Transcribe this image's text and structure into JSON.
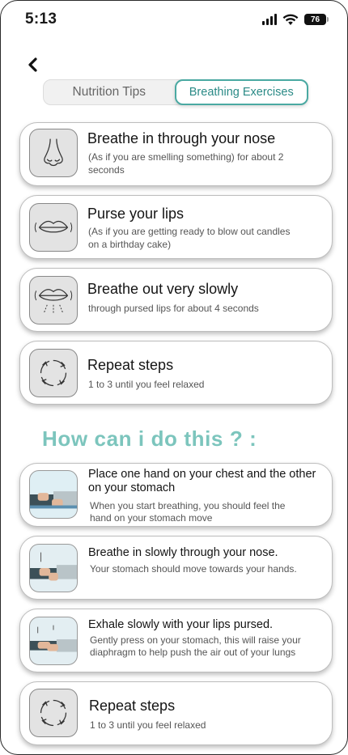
{
  "status": {
    "time": "5:13",
    "battery": "76"
  },
  "tabs": [
    {
      "label": "Nutrition Tips",
      "active": false
    },
    {
      "label": "Breathing Exercises",
      "active": true
    }
  ],
  "steps": [
    {
      "icon": "nose-icon",
      "title": "Breathe in through your nose",
      "desc": "(As if you are smelling something) for about 2 seconds"
    },
    {
      "icon": "lips-icon",
      "title": "Purse your lips",
      "desc": "(As if you are getting ready to blow out candles on a birthday cake)"
    },
    {
      "icon": "exhale-lips-icon",
      "title": "Breathe out very slowly",
      "desc": "through pursed lips for about 4 seconds"
    },
    {
      "icon": "repeat-icon",
      "title": "Repeat steps",
      "desc": "1 to 3 until you feel relaxed"
    }
  ],
  "howto_heading": "How can i do this ? :",
  "howto": [
    {
      "icon": "hands-chest-icon",
      "title": "Place one hand on your chest and the other on your stomach",
      "desc": "When you start breathing, you should feel the hand on your stomach move"
    },
    {
      "icon": "inhale-posture-icon",
      "title": "Breathe in slowly through your nose.",
      "desc": "Your stomach should move towards your hands."
    },
    {
      "icon": "exhale-posture-icon",
      "title": "Exhale slowly with your lips pursed.",
      "desc": "Gently press on your stomach, this will raise your diaphragm to help push the air out of your lungs"
    },
    {
      "icon": "repeat-icon",
      "title": "Repeat steps",
      "desc": "1 to 3 until you feel relaxed"
    }
  ],
  "colors": {
    "accent": "#4aa9a2",
    "heading": "#7cc5bd"
  }
}
